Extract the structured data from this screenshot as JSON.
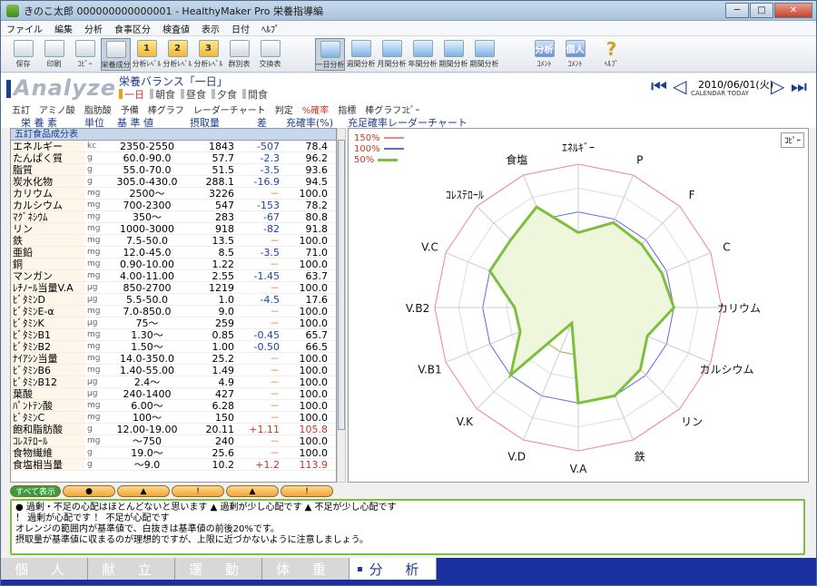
{
  "window": {
    "title": "きのこ太郎 000000000000001 - HealthyMaker Pro 栄養指導編"
  },
  "menu": [
    "ファイル",
    "編集",
    "分析",
    "食事区分",
    "検査値",
    "表示",
    "日付",
    "ﾍﾙﾌﾟ"
  ],
  "toolbar": [
    {
      "label": "保存",
      "icon": "save-icon"
    },
    {
      "label": "印刷",
      "icon": "print-icon"
    },
    {
      "label": "ｺﾋﾟｰ",
      "icon": "copy-icon"
    },
    {
      "label": "栄養成分",
      "icon": "nutrients-icon"
    },
    {
      "label": "分析ﾚﾍﾞﾙ",
      "icon": "level1-icon",
      "num": "1"
    },
    {
      "label": "分析ﾚﾍﾞﾙ",
      "icon": "level2-icon",
      "num": "2"
    },
    {
      "label": "分析ﾚﾍﾞﾙ",
      "icon": "level3-icon",
      "num": "3"
    },
    {
      "label": "群別表",
      "icon": "group-table-icon"
    },
    {
      "label": "交換表",
      "icon": "exchange-table-icon"
    },
    {
      "label": "一日分析",
      "icon": "day-analysis-icon"
    },
    {
      "label": "週間分析",
      "icon": "week-analysis-icon"
    },
    {
      "label": "月間分析",
      "icon": "month-analysis-icon"
    },
    {
      "label": "年間分析",
      "icon": "year-analysis-icon"
    },
    {
      "label": "期間分析",
      "icon": "term-analysis-icon"
    },
    {
      "label": "期間分析",
      "icon": "period-analysis-icon"
    },
    {
      "label": "ｺﾒﾝﾄ",
      "icon": "comment-icon",
      "text": "分析"
    },
    {
      "label": "ｺﾒﾝﾄ",
      "icon": "personal-comment-icon",
      "text": "個人"
    },
    {
      "label": "ﾍﾙﾌﾟ",
      "icon": "help-icon",
      "text": "?"
    }
  ],
  "header": {
    "app_label": "Analyze",
    "balance_title": "栄養バランス「一日」",
    "periods": [
      "一日",
      "朝食",
      "昼食",
      "夕食",
      "間食"
    ],
    "date": "2010/06/01(火)",
    "calendar": "CALENDAR",
    "today": "TODAY"
  },
  "options": [
    "五訂",
    "アミノ酸",
    "脂肪酸",
    "予備",
    "棒グラフ",
    "レーダーチャート",
    "判定",
    "%確率",
    "指標",
    "棒グラフｺﾋﾟｰ"
  ],
  "columns": {
    "name": "栄 養 素",
    "unit": "単位",
    "std": "基 準 値",
    "intake": "摂取量",
    "diff": "差",
    "rate": "充確率(%)",
    "chart": "充足確率レーダーチャート"
  },
  "section_title": "五訂食品成分表",
  "rows": [
    {
      "name": "エネルギー",
      "unit": "kc",
      "std": "2350-2550",
      "intake": "1843",
      "diff": "-507",
      "rate": "78.4"
    },
    {
      "name": "たんぱく質",
      "unit": "g",
      "std": "60.0-90.0",
      "intake": "57.7",
      "diff": "-2.3",
      "rate": "96.2"
    },
    {
      "name": "脂質",
      "unit": "g",
      "std": "55.0-70.0",
      "intake": "51.5",
      "diff": "-3.5",
      "rate": "93.6"
    },
    {
      "name": "炭水化物",
      "unit": "g",
      "std": "305.0-430.0",
      "intake": "288.1",
      "diff": "-16.9",
      "rate": "94.5"
    },
    {
      "name": "カリウム",
      "unit": "mg",
      "std": "2500～",
      "intake": "3226",
      "diff": "－",
      "rate": "100.0"
    },
    {
      "name": "カルシウム",
      "unit": "mg",
      "std": "700-2300",
      "intake": "547",
      "diff": "-153",
      "rate": "78.2"
    },
    {
      "name": "ﾏｸﾞﾈｼｳﾑ",
      "unit": "mg",
      "std": "350～",
      "intake": "283",
      "diff": "-67",
      "rate": "80.8"
    },
    {
      "name": "リン",
      "unit": "mg",
      "std": "1000-3000",
      "intake": "918",
      "diff": "-82",
      "rate": "91.8"
    },
    {
      "name": "鉄",
      "unit": "mg",
      "std": "7.5-50.0",
      "intake": "13.5",
      "diff": "－",
      "rate": "100.0"
    },
    {
      "name": "亜鉛",
      "unit": "mg",
      "std": "12.0-45.0",
      "intake": "8.5",
      "diff": "-3.5",
      "rate": "71.0"
    },
    {
      "name": "銅",
      "unit": "mg",
      "std": "0.90-10.00",
      "intake": "1.22",
      "diff": "－",
      "rate": "100.0"
    },
    {
      "name": "マンガン",
      "unit": "mg",
      "std": "4.00-11.00",
      "intake": "2.55",
      "diff": "-1.45",
      "rate": "63.7"
    },
    {
      "name": "ﾚﾁﾉｰﾙ当量V.A",
      "unit": "μg",
      "std": "850-2700",
      "intake": "1219",
      "diff": "－",
      "rate": "100.0"
    },
    {
      "name": "ﾋﾞﾀﾐﾝD",
      "unit": "μg",
      "std": "5.5-50.0",
      "intake": "1.0",
      "diff": "-4.5",
      "rate": "17.6"
    },
    {
      "name": "ﾋﾞﾀﾐﾝE-α",
      "unit": "mg",
      "std": "7.0-850.0",
      "intake": "9.0",
      "diff": "－",
      "rate": "100.0"
    },
    {
      "name": "ﾋﾞﾀﾐﾝK",
      "unit": "μg",
      "std": "75～",
      "intake": "259",
      "diff": "－",
      "rate": "100.0"
    },
    {
      "name": "ﾋﾞﾀﾐﾝB1",
      "unit": "mg",
      "std": "1.30～",
      "intake": "0.85",
      "diff": "-0.45",
      "rate": "65.7"
    },
    {
      "name": "ﾋﾞﾀﾐﾝB2",
      "unit": "mg",
      "std": "1.50～",
      "intake": "1.00",
      "diff": "-0.50",
      "rate": "66.5"
    },
    {
      "name": "ﾅｲｱｼﾝ当量",
      "unit": "mg",
      "std": "14.0-350.0",
      "intake": "25.2",
      "diff": "－",
      "rate": "100.0"
    },
    {
      "name": "ﾋﾞﾀﾐﾝB6",
      "unit": "mg",
      "std": "1.40-55.00",
      "intake": "1.49",
      "diff": "－",
      "rate": "100.0"
    },
    {
      "name": "ﾋﾞﾀﾐﾝB12",
      "unit": "μg",
      "std": "2.4～",
      "intake": "4.9",
      "diff": "－",
      "rate": "100.0"
    },
    {
      "name": "葉酸",
      "unit": "μg",
      "std": "240-1400",
      "intake": "427",
      "diff": "－",
      "rate": "100.0"
    },
    {
      "name": "ﾊﾟﾝﾄﾃﾝ酸",
      "unit": "mg",
      "std": "6.00～",
      "intake": "6.28",
      "diff": "－",
      "rate": "100.0"
    },
    {
      "name": "ﾋﾞﾀﾐﾝC",
      "unit": "mg",
      "std": "100～",
      "intake": "150",
      "diff": "－",
      "rate": "100.0"
    },
    {
      "name": "飽和脂肪酸",
      "unit": "g",
      "std": "12.00-19.00",
      "intake": "20.11",
      "diff": "+1.11",
      "rate": "105.8"
    },
    {
      "name": "ｺﾚｽﾃﾛｰﾙ",
      "unit": "mg",
      "std": "～750",
      "intake": "240",
      "diff": "－",
      "rate": "100.0"
    },
    {
      "name": "食物繊維",
      "unit": "g",
      "std": "19.0～",
      "intake": "25.6",
      "diff": "－",
      "rate": "100.0"
    },
    {
      "name": "食塩相当量",
      "unit": "g",
      "std": "～9.0",
      "intake": "10.2",
      "diff": "+1.2",
      "rate": "113.9"
    }
  ],
  "buttons": [
    "すべて表示",
    "●",
    "▲",
    "!",
    "▲",
    "!"
  ],
  "notes": [
    "● 過剰・不足の心配はほとんどないと思います ▲ 過剰が少し心配です ▲ 不足が少し心配です",
    "！ 過剰が心配です ！ 不足が心配です",
    "オレンジの範囲内が基準値で、白抜きは基準値の前後20%です。",
    "摂取量が基準値に収まるのが理想的ですが、上限に近づかないように注意しましょう。"
  ],
  "chart_data": {
    "type": "radar",
    "title": "充足確率レーダーチャート",
    "legend": [
      "150%",
      "100%",
      "50%"
    ],
    "copy_label": "ｺﾋﾟｰ",
    "axes": [
      "ｴﾈﾙｷﾞｰ",
      "P",
      "F",
      "C",
      "カリウム",
      "カルシウム",
      "リン",
      "鉄",
      "V.A",
      "V.D",
      "V.K",
      "V.B1",
      "V.B2",
      "V.C",
      "ｺﾚｽﾃﾛｰﾙ",
      "食塩"
    ],
    "values": [
      78.4,
      96.2,
      93.6,
      94.5,
      100.0,
      78.2,
      91.8,
      100.0,
      100.0,
      17.6,
      100.0,
      65.7,
      66.5,
      100.0,
      100.0,
      113.9
    ],
    "rings": [
      50,
      100,
      150
    ],
    "max": 150
  },
  "tabs": [
    "個 人",
    "献 立",
    "運 動",
    "体 重",
    "分 析"
  ],
  "active_tab": 4
}
